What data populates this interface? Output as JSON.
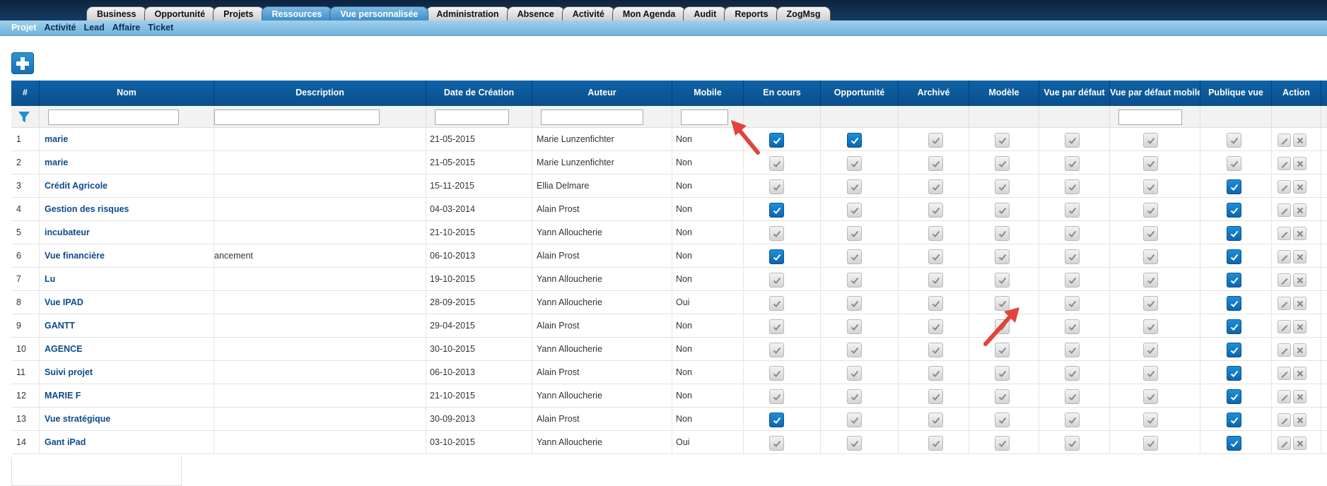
{
  "topnav": {
    "tabs": [
      "Business",
      "Opportunité",
      "Projets",
      "Ressources",
      "Vue personnalisée",
      "Administration",
      "Absence",
      "Activité",
      "Mon Agenda",
      "Audit",
      "Reports",
      "ZogMsg"
    ],
    "active_tabs": [
      "Ressources",
      "Vue personnalisée"
    ]
  },
  "subnav": {
    "items": [
      "Projet",
      "Activité",
      "Lead",
      "Affaire",
      "Ticket"
    ],
    "active": "Projet"
  },
  "table": {
    "columns": [
      "#",
      "Nom",
      "Description",
      "Date de Création",
      "Auteur",
      "Mobile",
      "En cours",
      "Opportunité",
      "Archivé",
      "Modèle",
      "Vue par défaut",
      "Vue par défaut mobile",
      "Publique vue",
      "Action"
    ],
    "rows": [
      {
        "num": "1",
        "nom": "marie",
        "description": "",
        "date": "21-05-2015",
        "auteur": "Marie Lunzenfichter",
        "mobile": "Non",
        "en_cours": true,
        "opportunite": true,
        "archive": false,
        "modele": false,
        "vue_defaut": false,
        "vue_defaut_mobile": false,
        "publique": false
      },
      {
        "num": "2",
        "nom": "marie",
        "description": "",
        "date": "21-05-2015",
        "auteur": "Marie Lunzenfichter",
        "mobile": "Non",
        "en_cours": false,
        "opportunite": false,
        "archive": false,
        "modele": false,
        "vue_defaut": false,
        "vue_defaut_mobile": false,
        "publique": false
      },
      {
        "num": "3",
        "nom": "Crédit Agricole",
        "description": "",
        "date": "15-11-2015",
        "auteur": "Ellia Delmare",
        "mobile": "Non",
        "en_cours": false,
        "opportunite": false,
        "archive": false,
        "modele": false,
        "vue_defaut": false,
        "vue_defaut_mobile": false,
        "publique": true
      },
      {
        "num": "4",
        "nom": "Gestion des risques",
        "description": "",
        "date": "04-03-2014",
        "auteur": "Alain Prost",
        "mobile": "Non",
        "en_cours": true,
        "opportunite": false,
        "archive": false,
        "modele": false,
        "vue_defaut": false,
        "vue_defaut_mobile": false,
        "publique": true
      },
      {
        "num": "5",
        "nom": "incubateur",
        "description": "",
        "date": "21-10-2015",
        "auteur": "Yann Alloucherie",
        "mobile": "Non",
        "en_cours": false,
        "opportunite": false,
        "archive": false,
        "modele": false,
        "vue_defaut": false,
        "vue_defaut_mobile": false,
        "publique": true
      },
      {
        "num": "6",
        "nom": "Vue financière",
        "description": "ancement",
        "date": "06-10-2013",
        "auteur": "Alain Prost",
        "mobile": "Non",
        "en_cours": true,
        "opportunite": false,
        "archive": false,
        "modele": false,
        "vue_defaut": false,
        "vue_defaut_mobile": false,
        "publique": true
      },
      {
        "num": "7",
        "nom": "Lu",
        "description": "",
        "date": "19-10-2015",
        "auteur": "Yann Alloucherie",
        "mobile": "Non",
        "en_cours": false,
        "opportunite": false,
        "archive": false,
        "modele": false,
        "vue_defaut": false,
        "vue_defaut_mobile": false,
        "publique": true
      },
      {
        "num": "8",
        "nom": "Vue IPAD",
        "description": "",
        "date": "28-09-2015",
        "auteur": "Yann Alloucherie",
        "mobile": "Oui",
        "en_cours": false,
        "opportunite": false,
        "archive": false,
        "modele": false,
        "vue_defaut": false,
        "vue_defaut_mobile": false,
        "publique": true
      },
      {
        "num": "9",
        "nom": "GANTT",
        "description": "",
        "date": "29-04-2015",
        "auteur": "Alain Prost",
        "mobile": "Non",
        "en_cours": false,
        "opportunite": false,
        "archive": false,
        "modele": false,
        "vue_defaut": false,
        "vue_defaut_mobile": false,
        "publique": true
      },
      {
        "num": "10",
        "nom": "AGENCE",
        "description": "",
        "date": "30-10-2015",
        "auteur": "Yann Alloucherie",
        "mobile": "Non",
        "en_cours": false,
        "opportunite": false,
        "archive": false,
        "modele": false,
        "vue_defaut": false,
        "vue_defaut_mobile": false,
        "publique": true
      },
      {
        "num": "11",
        "nom": "Suivi projet",
        "description": "",
        "date": "06-10-2013",
        "auteur": "Alain Prost",
        "mobile": "Non",
        "en_cours": false,
        "opportunite": false,
        "archive": false,
        "modele": false,
        "vue_defaut": false,
        "vue_defaut_mobile": false,
        "publique": true
      },
      {
        "num": "12",
        "nom": "MARIE F",
        "description": "",
        "date": "21-10-2015",
        "auteur": "Yann Alloucherie",
        "mobile": "Non",
        "en_cours": false,
        "opportunite": false,
        "archive": false,
        "modele": false,
        "vue_defaut": false,
        "vue_defaut_mobile": false,
        "publique": true
      },
      {
        "num": "13",
        "nom": "Vue stratégique",
        "description": "",
        "date": "30-09-2013",
        "auteur": "Alain Prost",
        "mobile": "Non",
        "en_cours": true,
        "opportunite": false,
        "archive": false,
        "modele": false,
        "vue_defaut": false,
        "vue_defaut_mobile": false,
        "publique": true
      },
      {
        "num": "14",
        "nom": "Gant iPad",
        "description": "",
        "date": "03-10-2015",
        "auteur": "Yann Alloucherie",
        "mobile": "Oui",
        "en_cours": false,
        "opportunite": false,
        "archive": false,
        "modele": false,
        "vue_defaut": false,
        "vue_defaut_mobile": false,
        "publique": true
      }
    ]
  },
  "icons": {
    "add": "plus-icon",
    "filter": "funnel-icon",
    "edit": "pencil-icon",
    "delete": "cross-icon",
    "annotation": "red-arrow"
  },
  "colors": {
    "nav_dark": "#0d2440",
    "subnav": "#7fbfe3",
    "header": "#0a4f8c",
    "checkbox_on": "#0c65ae",
    "link": "#0d4a8c",
    "arrow": "#e0443a"
  }
}
